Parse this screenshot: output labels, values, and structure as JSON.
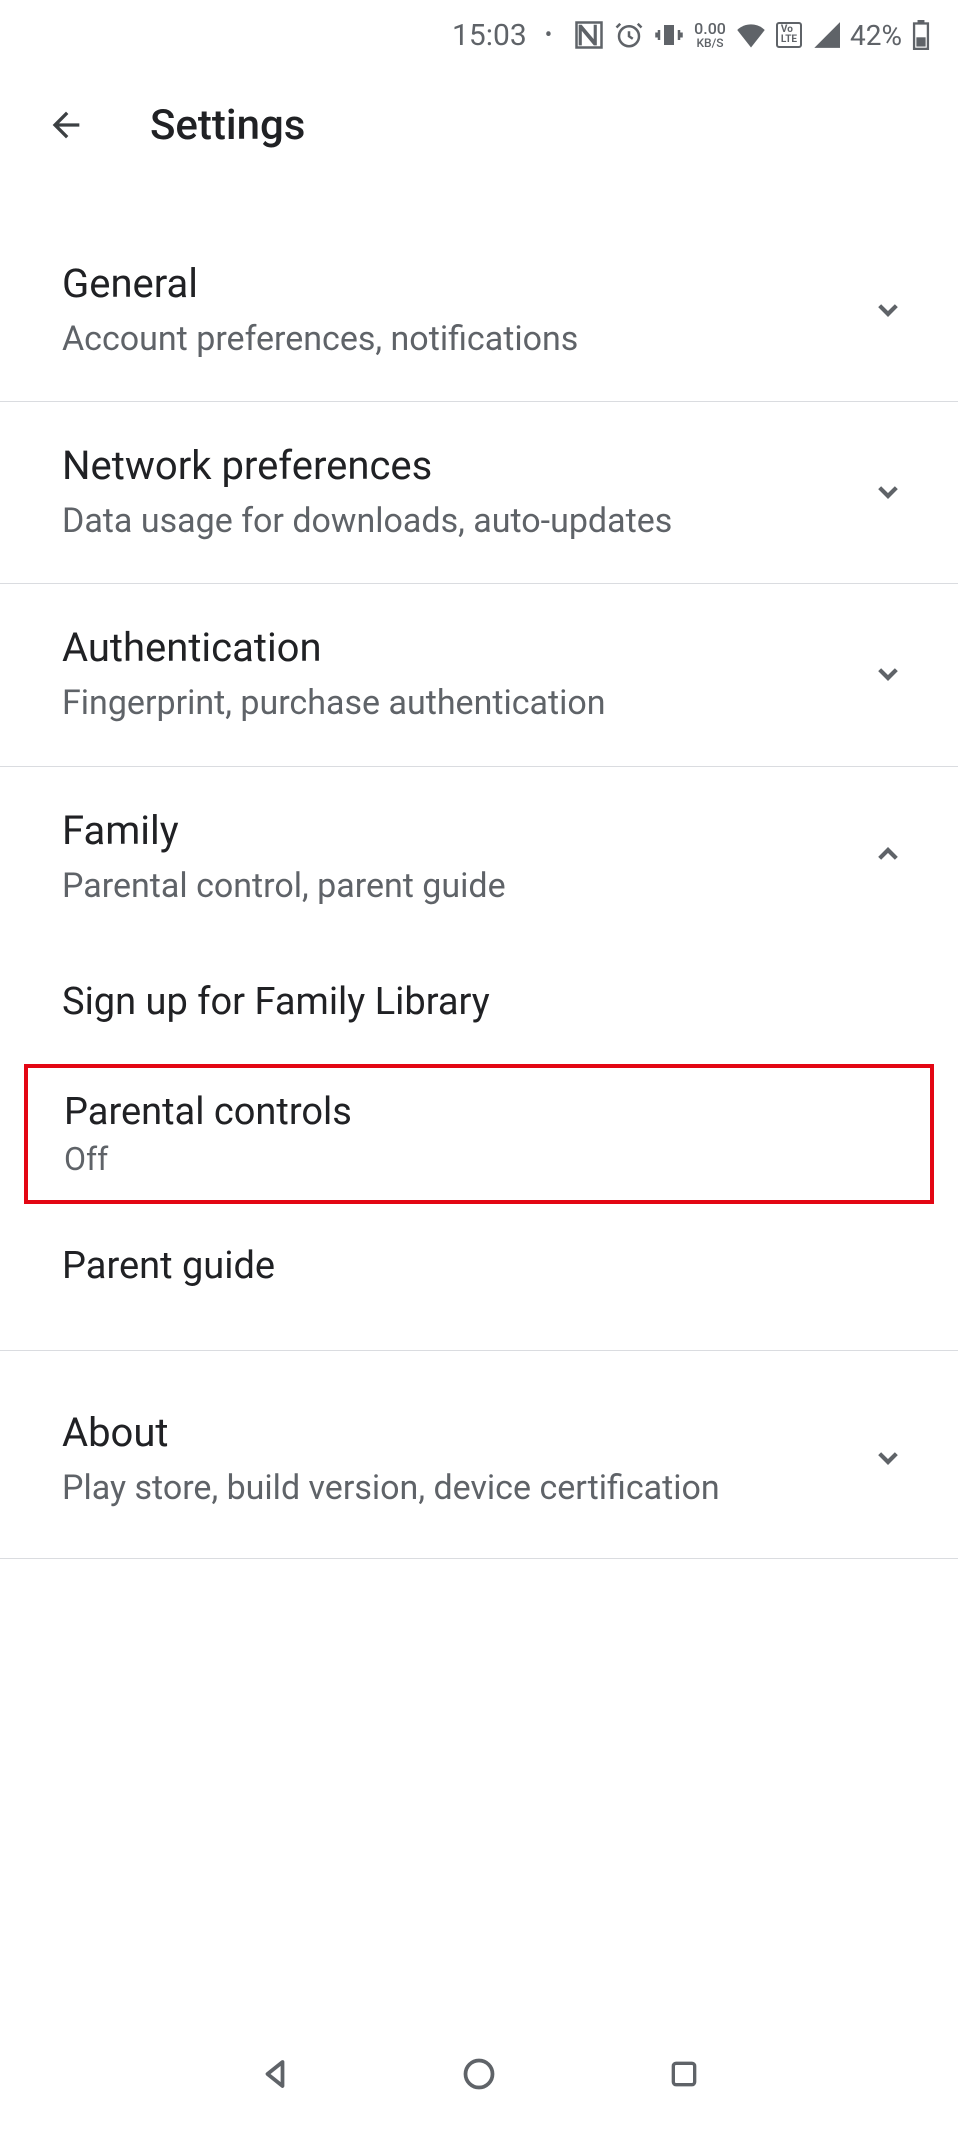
{
  "status": {
    "time": "15:03",
    "data_rate": "0.00",
    "data_unit": "KB/S",
    "network_badge": "VoLTE",
    "battery_pct": "42%"
  },
  "header": {
    "title": "Settings"
  },
  "sections": {
    "general": {
      "title": "General",
      "subtitle": "Account preferences, notifications"
    },
    "network": {
      "title": "Network preferences",
      "subtitle": "Data usage for downloads, auto-updates"
    },
    "auth": {
      "title": "Authentication",
      "subtitle": "Fingerprint, purchase authentication"
    },
    "family": {
      "title": "Family",
      "subtitle": "Parental control, parent guide",
      "items": {
        "signup": "Sign up for Family Library",
        "parental_controls": {
          "title": "Parental controls",
          "status": "Off"
        },
        "parent_guide": "Parent guide"
      }
    },
    "about": {
      "title": "About",
      "subtitle": "Play store, build version, device certification"
    }
  }
}
